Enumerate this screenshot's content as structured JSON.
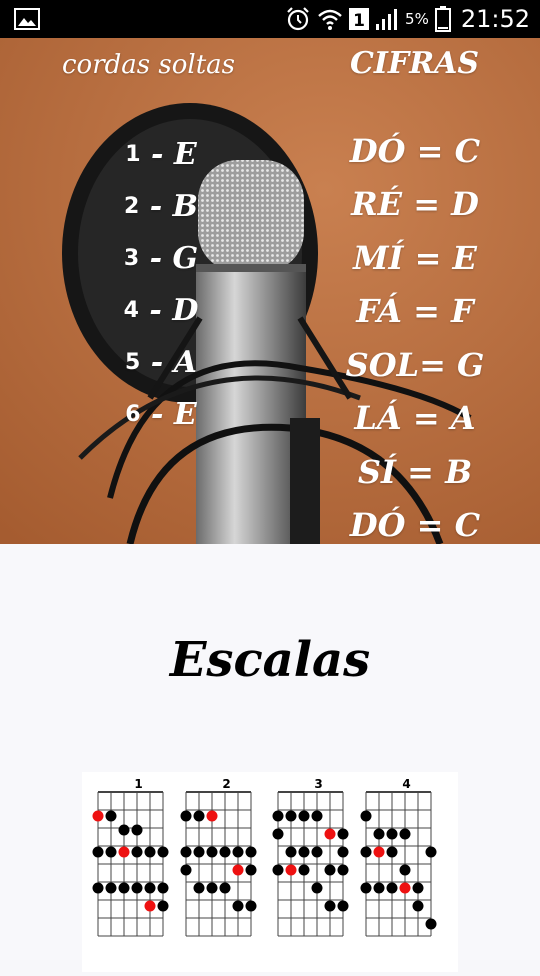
{
  "status_bar": {
    "battery_pct": "5%",
    "time": "21:52",
    "sim_badge": "1"
  },
  "hero": {
    "header_left": "cordas soltas",
    "header_right": "CIFRAS",
    "strings": [
      {
        "num": "1",
        "note": "E"
      },
      {
        "num": "2",
        "note": "B"
      },
      {
        "num": "3",
        "note": "G"
      },
      {
        "num": "4",
        "note": "D"
      },
      {
        "num": "5",
        "note": "A"
      },
      {
        "num": "6",
        "note": "E"
      }
    ],
    "ciphers": [
      "DÓ = C",
      "RÉ = D",
      "MÍ = E",
      "FÁ = F",
      "SOL= G",
      "LÁ = A",
      "SÍ = B",
      "DÓ = C"
    ]
  },
  "content": {
    "title": "Escalas",
    "scale_diagrams": [
      {
        "label": "1"
      },
      {
        "label": "2"
      },
      {
        "label": "3"
      },
      {
        "label": "4"
      }
    ]
  },
  "colors": {
    "hero_bg": "#b9703f",
    "dot_black": "#000000",
    "dot_red": "#ee1111"
  },
  "icons": [
    "gallery-icon",
    "alarm-icon",
    "wifi-icon",
    "signal-icon",
    "battery-icon"
  ]
}
